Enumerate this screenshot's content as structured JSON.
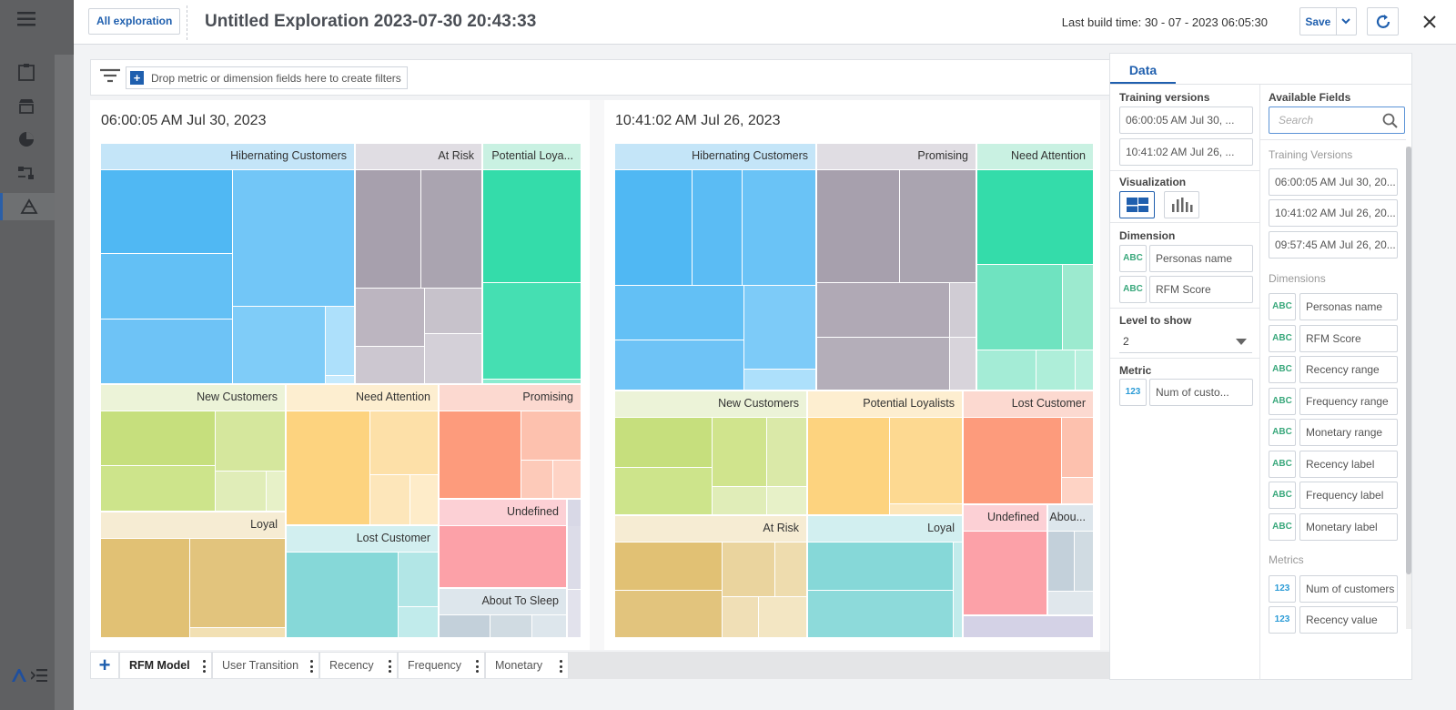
{
  "header": {
    "all_exploration": "All exploration",
    "title": "Untitled Exploration 2023-07-30 20:43:33",
    "last_build": "Last build time: 30 - 07 - 2023 06:05:30",
    "save": "Save"
  },
  "filters": {
    "placeholder": "Drop metric or dimension fields here to create filters"
  },
  "charts": [
    {
      "title": "06:00:05 AM Jul 30, 2023",
      "groups": [
        "Hibernating Customers",
        "At Risk",
        "Potential Loya...",
        "New Customers",
        "Need Attention",
        "Promising",
        "Loyal",
        "Lost Customer",
        "Undefined",
        "About To Sleep"
      ]
    },
    {
      "title": "10:41:02 AM Jul 26, 2023",
      "groups": [
        "Hibernating Customers",
        "Promising",
        "Need Attention",
        "New Customers",
        "Potential Loyalists",
        "Lost Customer",
        "At Risk",
        "Loyal",
        "Undefined",
        "Abou..."
      ]
    }
  ],
  "tabs": [
    "RFM Model",
    "User Transition",
    "Recency",
    "Frequency",
    "Monetary"
  ],
  "panel": {
    "tab": "Data",
    "training_versions_label": "Training versions",
    "training_versions": [
      "06:00:05 AM Jul 30, ...",
      "10:41:02 AM Jul 26, ..."
    ],
    "visualization_label": "Visualization",
    "dimension_label": "Dimension",
    "dimensions": [
      "Personas name",
      "RFM Score"
    ],
    "level_label": "Level to show",
    "level_value": "2",
    "metric_label": "Metric",
    "metric": "Num of custo...",
    "available_label": "Available Fields",
    "search_placeholder": "Search",
    "tv_heading": "Training Versions",
    "available_versions": [
      "06:00:05 AM Jul 30, 20...",
      "10:41:02 AM Jul 26, 20...",
      "09:57:45 AM Jul 26, 20..."
    ],
    "dimensions_heading": "Dimensions",
    "available_dimensions": [
      "Personas name",
      "RFM Score",
      "Recency range",
      "Frequency range",
      "Monetary range",
      "Recency label",
      "Frequency label",
      "Monetary label"
    ],
    "metrics_heading": "Metrics",
    "available_metrics": [
      "Num of customers",
      "Recency value"
    ],
    "abc": "ABC",
    "n123": "123"
  }
}
